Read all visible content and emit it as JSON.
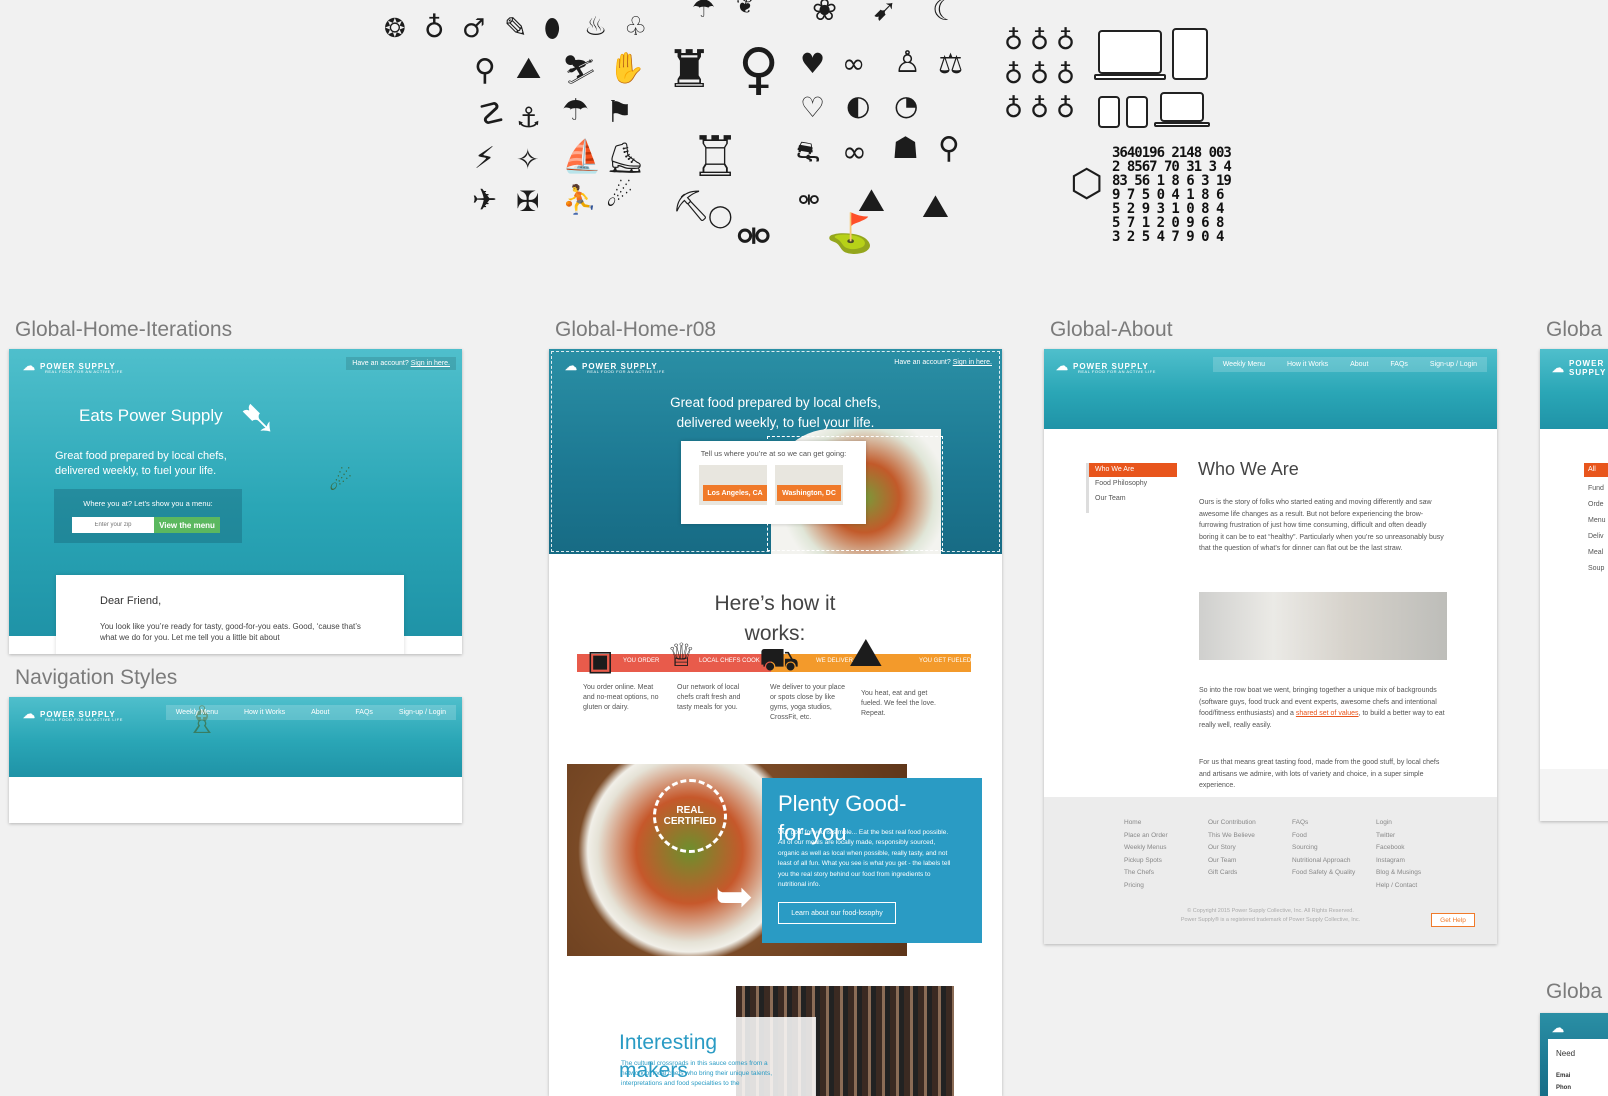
{
  "board_labels": {
    "home_iterations": "Global-Home-Iterations",
    "home_r08": "Global-Home-r08",
    "about": "Global-About",
    "cut_right_top": "Globa",
    "nav_styles": "Navigation Styles",
    "cut_right_bottom": "Globa"
  },
  "icon_sheet": {
    "number_grid": "3640196 2148 0032 8567 70 31 3 4 83 56 1 8 6 3 19 9 7 5 0 4 1 8 6 5 2 9 3 1 0 8 4 5 7 1 2 0 9 6 8 3 2 5 4 7 9 0 4"
  },
  "brand": {
    "name": "POWER SUPPLY",
    "tagline": "REAL FOOD FOR AN ACTIVE LIFE",
    "account_prompt": "Have an account?",
    "sign_in": "Sign in here."
  },
  "iterations": {
    "title": "Eats Power Supply",
    "subtitle_1": "Great food prepared by local chefs,",
    "subtitle_2": "delivered weekly, to fuel your life.",
    "zip_prompt": "Where you at? Let’s show you a menu:",
    "zip_placeholder": "Enter your zip",
    "cta": "View the menu",
    "letter_greeting": "Dear Friend,",
    "letter_body": "You look like you’re ready for tasty, good-for-you eats. Good, ‘cause that’s what we do for you. Let me tell you a little bit about"
  },
  "r08": {
    "hero_1": "Great food prepared by local chefs,",
    "hero_2": "delivered weekly, to fuel your life.",
    "location_prompt": "Tell us where you’re at so we can get going:",
    "city_1": "Los Angeles, CA",
    "city_2": "Washington, DC",
    "how_title": "Here’s how it works:",
    "steps": [
      {
        "tag": "YOU ORDER",
        "text": "You order online. Meat and no-meat options, no gluten or dairy."
      },
      {
        "tag": "LOCAL CHEFS COOK",
        "text": "Our network of local chefs craft fresh and tasty meals for you."
      },
      {
        "tag": "WE DELIVER",
        "text": "We deliver to your place or spots close by like gyms, yoga studios, CrossFit, etc."
      },
      {
        "tag": "YOU GET FUELED",
        "text": "You heat, eat and get fueled. We feel the love. Repeat."
      }
    ],
    "plenty_title": "Plenty Good-for-you",
    "plenty_body": "Our goal for you is simple... Eat the best real food possible. All of our meals are locally made, responsibly sourced, organic as well as local when possible, really tasty, and not least of all fun. What you see is what you get - the labels tell you the real story behind our food from ingredients to nutritional info.",
    "plenty_cta": "Learn about our food-losophy",
    "stamp": "REAL CERTIFIED",
    "makers_title": "Interesting makers",
    "makers_body": "The cultural crossroads in this sauce comes from a network of local chefs who bring their unique talents, interpretations and food specialties to the"
  },
  "nav_styles": {
    "items": [
      "Weekly Menu",
      "How it Works",
      "About",
      "FAQs",
      "Sign-up / Login"
    ]
  },
  "about": {
    "nav": [
      "Weekly Menu",
      "How it Works",
      "About",
      "FAQs",
      "Sign-up / Login"
    ],
    "side": [
      "Who We Are",
      "Food Philosophy",
      "Our Team"
    ],
    "heading": "Who We Are",
    "p1": "Ours is the story of folks who started eating and moving differently and saw awesome life changes as a result. But not before experiencing the brow-furrowing frustration of just how time consuming, difficult and often deadly boring it can be to eat “healthy”. Particularly when you’re so unreasonably busy that the question of what’s for dinner can flat out be the last straw.",
    "p2_a": "So into the row boat we went, bringing together a unique mix of backgrounds (software guys, food truck and event experts, awesome chefs and intentional food/fitness enthusiasts) and a",
    "p2_link": "shared set of values",
    "p2_b": ", to build a better way to eat really well, really easily.",
    "p3": "For us that means great tasting food, made from the good stuff, by local chefs and artisans we admire, with lots of variety and choice, in a super simple experience.",
    "footer_cols": [
      [
        "Home",
        "Place an Order",
        "Weekly Menus",
        "Pickup Spots",
        "The Chefs",
        "Pricing"
      ],
      [
        "Our Contribution",
        "This We Believe",
        "Our Story",
        "Our Team",
        "Gift Cards"
      ],
      [
        "FAQs",
        "Food",
        "Sourcing",
        "Nutritional Approach",
        "Food Safety & Quality"
      ],
      [
        "Login",
        "Twitter",
        "Facebook",
        "Instagram",
        "Blog & Musings",
        "Help / Contact"
      ]
    ],
    "copyright_1": "© Copyright 2015 Power Supply Collective, Inc. All Rights Reserved.",
    "copyright_2": "Power Supply® is a registered trademark of Power Supply Collective, Inc.",
    "help": "Get Help"
  },
  "cut_board": {
    "items": [
      "All",
      "Fund",
      "Orde",
      "Menu",
      "Deliv",
      "Meal",
      "Soup"
    ],
    "bottom_text_1": "Need",
    "bottom_text_2": "Emai",
    "bottom_text_3": "Phon"
  },
  "colors": {
    "canvas": "#f1f1f1",
    "teal": "#2aa6b6",
    "orange": "#f07a2a",
    "green": "#5bb85f",
    "blue_card": "#2a9bc4"
  }
}
